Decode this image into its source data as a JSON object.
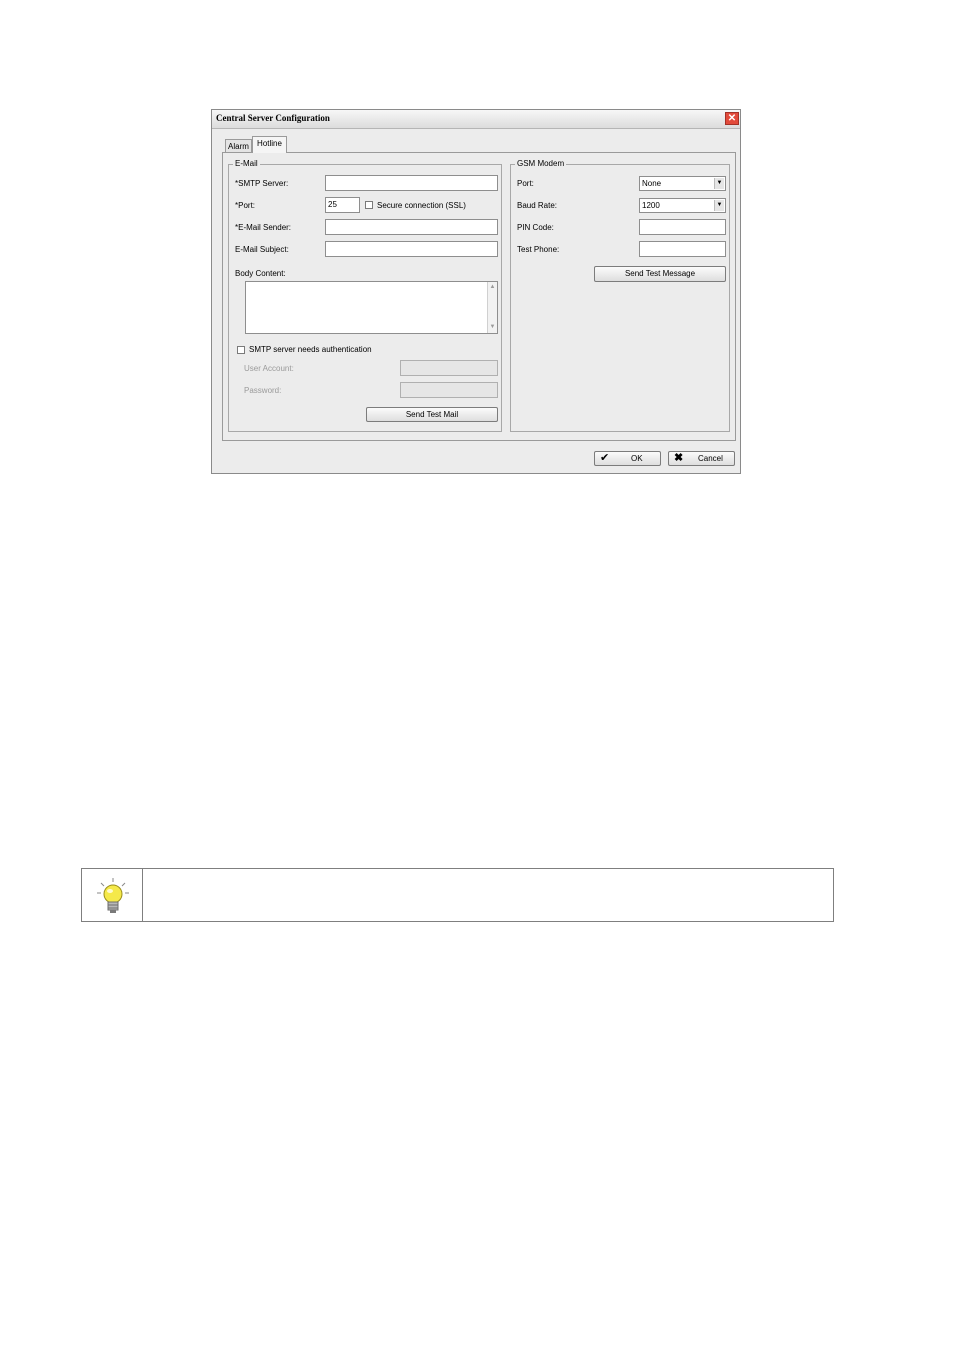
{
  "dialog": {
    "title": "Central Server Configuration",
    "close_glyph": "✕",
    "tabs": [
      {
        "label": "Alarm",
        "active": false
      },
      {
        "label": "Hotline",
        "active": true
      }
    ],
    "ok_label": "OK",
    "cancel_label": "Cancel"
  },
  "email": {
    "legend": "E-Mail",
    "smtp_server_label": "*SMTP Server:",
    "smtp_server_value": "",
    "port_label": "*Port:",
    "port_value": "25",
    "secure_label": "Secure connection (SSL)",
    "secure_checked": false,
    "sender_label": "*E-Mail Sender:",
    "sender_value": "",
    "subject_label": "E-Mail Subject:",
    "subject_value": "",
    "body_label": "Body Content:",
    "body_value": "",
    "auth_label": "SMTP server needs authentication",
    "auth_checked": false,
    "user_account_label": "User Account:",
    "password_label": "Password:",
    "send_test_label": "Send Test Mail"
  },
  "gsm": {
    "legend": "GSM Modem",
    "port_label": "Port:",
    "port_value": "None",
    "baud_label": "Baud Rate:",
    "baud_value": "1200",
    "pin_label": "PIN Code:",
    "pin_value": "",
    "phone_label": "Test Phone:",
    "phone_value": "",
    "send_test_label": "Send Test Message"
  },
  "tip": {
    "icon": "lightbulb-icon",
    "text": ""
  },
  "colors": {
    "dialog_bg": "#ececec",
    "close_button": "#e24a3b",
    "bulb": "#f5e94a"
  }
}
